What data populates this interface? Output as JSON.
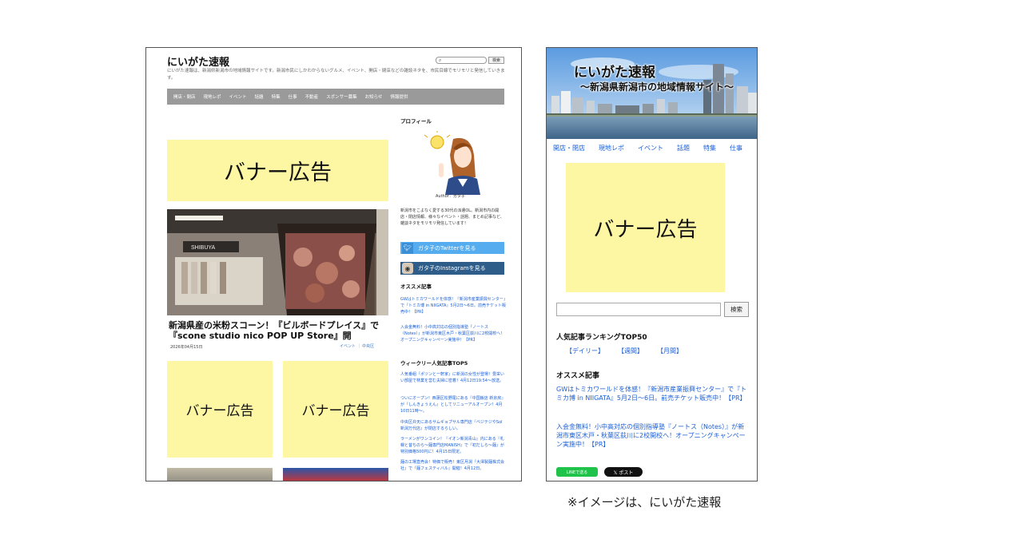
{
  "desktop": {
    "site_title": "にいがた速報",
    "tagline": "にいがた速報は、新潟県新潟市の地域情報サイトです。新潟市民にしかわからないグルメ、イベント、開店・閉店などの雑談ネタを、市民目線でモリモリと発信していきます。",
    "search_button": "検索",
    "search_icon": "search-icon",
    "nav": [
      "開店・閉店",
      "現地レポ",
      "イベント",
      "話題",
      "特集",
      "仕事",
      "不動産",
      "スポンサー募集",
      "お知らせ",
      "情報提供"
    ],
    "banner_text": "バナー広告",
    "article": {
      "title": "新潟県産の米粉スコーン！『ビルボードプレイス』で『scone studio nico POP UP Store』開",
      "date": "2026年04月15日",
      "category": "イベント ｜ 中央区"
    },
    "sidebar": {
      "profile_heading": "プロフィール",
      "author_label": "Author：ガタ子",
      "profile_text": "新潟市をこよなく愛する30代の派遣OL。新潟市内の開店・閉店情報、様々なイベント・話題、まとめ記事など、雑談ネタをモリモリ発信しています！",
      "twitter_button": "ガタ子のTwitterを見る",
      "instagram_button": "ガタ子のInstagramを見る",
      "recommended_heading": "オススメ記事",
      "recommended": [
        "GWはトミカワールドを体感！『新潟市産業振興センター』で『トミカ博 in NIIGATA』5月2日〜6日。前売チケット販売中！【PR】",
        "入会金無料！小中高対応の個別指導塾『ノートス（Notes）』が新潟市東区木戸・秋葉区荻川に2校開校へ！オープニングキャンペーン実施中！【PR】"
      ],
      "weekly_heading": "ウィークリー人気記事TOP5",
      "weekly": [
        "人気番組『ポツンと一軒家』に新潟の女性が登場！豊栄いい部屋で林業を営む夫婦に密着！4月12日19:54〜放送。",
        "ついにオープン！西蒲区松野尾にある『中国飯店 新京房』が『しんきょうえん』としてリニューアルオープン！4月10日11時〜。",
        "中央区弁天にあるサムギョプサル専門店『ベジテジやSol 新潟万代店』が閉店するらしい。",
        "ラーメンがワンコイン！『イオン新潟青山』内にある『札幌と昔ちのら〜麺専門店MANISH』で『初だしら〜麺』が特別価格500円に！4月15日限定。",
        "麺の工場直売会！特価で販売！東区月潟『大澤製麺株式会社』で『麺フェスティバル』開催！4月12日。"
      ]
    }
  },
  "mobile": {
    "hero_title": "にいがた速報",
    "hero_subtitle": "〜新潟県新潟市の地域情報サイト〜",
    "nav": [
      "開店・閉店",
      "現地レポ",
      "イベント",
      "話題",
      "特集",
      "仕事"
    ],
    "banner_text": "バナー広告",
    "search_button": "検索",
    "ranking_heading": "人気記事ランキングTOP50",
    "ranking_links": [
      "【デイリー】",
      "【週間】",
      "【月間】"
    ],
    "recommended_heading": "オススメ記事",
    "recommended": [
      "GWはトミカワールドを体感！『新潟市産業振興センター』で『トミカ博 in NIIGATA』5月2日〜6日。前売チケット販売中！【PR】",
      "入会金無料！小中高対応の個別指導塾『ノートス（Notes）』が新潟市東区木戸・秋葉区荻川に2校開校へ！オープニングキャンペーン実施中！【PR】"
    ],
    "line_button": "LINEで送る",
    "x_button": "𝕏 ポスト"
  },
  "caption": "※イメージは、にいがた速報",
  "colors": {
    "banner": "#fdf6a3",
    "nav": "#9a9a9a",
    "twitter": "#55acee",
    "instagram": "#2e5d8a",
    "link": "#1a5fd6",
    "line": "#1fc34a"
  }
}
